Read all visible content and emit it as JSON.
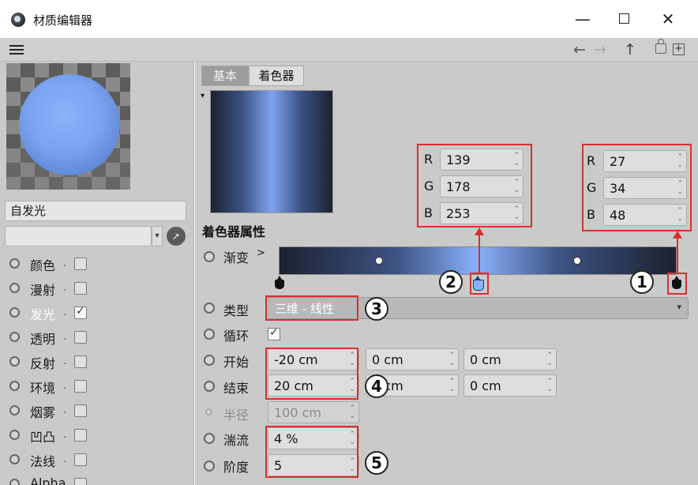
{
  "window": {
    "title": "材质编辑器",
    "min_glyph": "—",
    "close_glyph": "✕"
  },
  "toolbar": {
    "back_glyph": "←",
    "forward_glyph": "→",
    "up_glyph": "↑",
    "new_glyph": "+"
  },
  "left": {
    "material_name": "自发光",
    "channels": [
      {
        "label": "颜色",
        "checked": false
      },
      {
        "label": "漫射",
        "checked": false
      },
      {
        "label": "发光",
        "checked": true
      },
      {
        "label": "透明",
        "checked": false
      },
      {
        "label": "反射",
        "checked": false
      },
      {
        "label": "环境",
        "checked": false
      },
      {
        "label": "烟雾",
        "checked": false
      },
      {
        "label": "凹凸",
        "checked": false
      },
      {
        "label": "法线",
        "checked": false
      },
      {
        "label": "Alpha",
        "checked": false
      }
    ],
    "dot": "."
  },
  "tabs": {
    "basic": "基本",
    "shader": "着色器"
  },
  "shader": {
    "section_title": "着色器属性",
    "gradient_label": "渐变",
    "gradient_arrow": ">",
    "type_label": "类型",
    "type_value": "三维 - 线性",
    "loop_label": "循环",
    "loop_checked": true,
    "start_label": "开始",
    "start_values": [
      "-20 cm",
      "0 cm",
      "0 cm"
    ],
    "end_label": "结束",
    "end_values": [
      "20 cm",
      "0 cm",
      "0 cm"
    ],
    "radius_label": "半径",
    "radius_value": "100 cm",
    "turbulence_label": "湍流",
    "turbulence_value": "4 %",
    "octaves_label": "阶度",
    "octaves_value": "5"
  },
  "knot_color_mid": {
    "r_label": "R",
    "g_label": "G",
    "b_label": "B",
    "r": "139",
    "g": "178",
    "b": "253"
  },
  "knot_color_end": {
    "r_label": "R",
    "g_label": "G",
    "b_label": "B",
    "r": "27",
    "g": "34",
    "b": "48"
  },
  "annotations": [
    "1",
    "2",
    "3",
    "4",
    "5"
  ],
  "colors": {
    "highlight": "#d92f2f",
    "gradient_light": "#8bb2fd",
    "gradient_dark": "#1b2230"
  }
}
